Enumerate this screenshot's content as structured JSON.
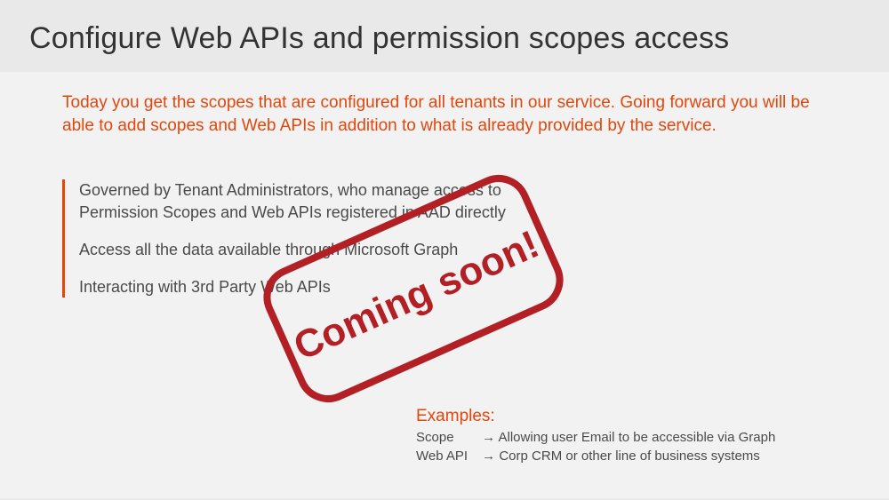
{
  "title": "Configure Web APIs and permission scopes access",
  "intro": "Today you get the scopes that are configured for all tenants in our service. Going forward you will be able to add scopes and Web APIs in addition to what is already provided by the service.",
  "bullets": {
    "b1": "Governed by Tenant Administrators, who manage access to Permission Scopes and Web APIs registered in AAD directly",
    "b2": "Access all the data available through Microsoft Graph",
    "b3": "Interacting with 3rd Party Web APIs"
  },
  "examples": {
    "heading": "Examples:",
    "row1": {
      "key": "Scope",
      "arrow": "→",
      "text": "Allowing user Email to be accessible via Graph"
    },
    "row2": {
      "key": "Web API",
      "arrow": "→",
      "text": "Corp CRM or other line of business systems"
    }
  },
  "stamp_text": "Coming soon!",
  "colors": {
    "accent": "#e2470c",
    "stamp": "#b21f24"
  }
}
